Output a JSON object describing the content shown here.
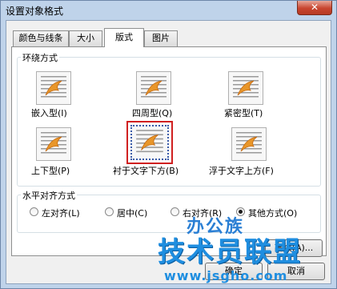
{
  "window": {
    "title": "设置对象格式",
    "close_label": "✕"
  },
  "tabs": [
    {
      "label": "颜色与线条",
      "active": false
    },
    {
      "label": "大小",
      "active": false
    },
    {
      "label": "版式",
      "active": true
    },
    {
      "label": "图片",
      "active": false
    }
  ],
  "wrap_group": {
    "title": "环绕方式",
    "options": [
      {
        "label": "嵌入型(I)",
        "icon": "inline-icon",
        "selected": false
      },
      {
        "label": "四周型(Q)",
        "icon": "square-wrap-icon",
        "selected": false
      },
      {
        "label": "紧密型(T)",
        "icon": "tight-wrap-icon",
        "selected": false
      },
      {
        "label": "上下型(P)",
        "icon": "top-bottom-icon",
        "selected": false
      },
      {
        "label": "衬于文字下方(B)",
        "icon": "behind-text-icon",
        "selected": true
      },
      {
        "label": "浮于文字上方(F)",
        "icon": "in-front-text-icon",
        "selected": false
      }
    ]
  },
  "align_group": {
    "title": "水平对齐方式",
    "options": [
      {
        "label": "左对齐(L)",
        "checked": false
      },
      {
        "label": "居中(C)",
        "checked": false
      },
      {
        "label": "右对齐(R)",
        "checked": false
      },
      {
        "label": "其他方式(O)",
        "checked": true
      }
    ]
  },
  "buttons": {
    "advanced": "高级(A)...",
    "ok": "确定",
    "cancel": "取消"
  },
  "watermark": {
    "line1": "办公族",
    "line2": "技术员联盟",
    "line3": "www.jsgho.com"
  },
  "colors": {
    "title_bg": "#bfd3ea",
    "close_red": "#c8452f",
    "selection_red": "#d02020",
    "watermark_blue": "#1f8ee0"
  }
}
